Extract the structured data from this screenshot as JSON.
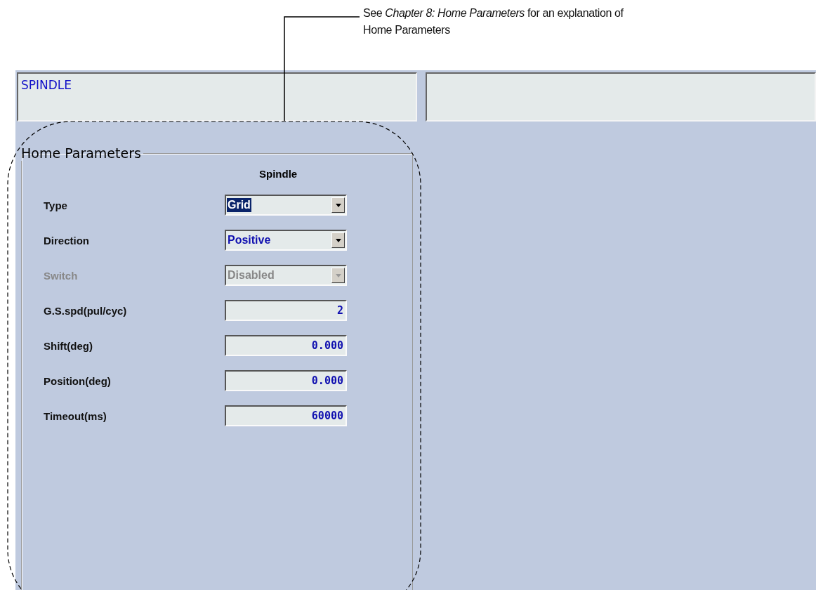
{
  "callout": {
    "text": "See *Chapter 8: Home Parameters* for an explanation of Home Parameters"
  },
  "header": {
    "title": "SPINDLE"
  },
  "group": {
    "title": "Home Parameters",
    "column": "Spindle",
    "rows": [
      {
        "kind": "dropdown",
        "label": "Type",
        "value": "Grid",
        "highlighted": true,
        "disabled": false
      },
      {
        "kind": "dropdown",
        "label": "Direction",
        "value": "Positive",
        "highlighted": false,
        "disabled": false
      },
      {
        "kind": "dropdown",
        "label": "Switch",
        "value": "Disabled",
        "highlighted": false,
        "disabled": true
      },
      {
        "kind": "number",
        "label": "G.S.spd(pul/cyc)",
        "value": "2",
        "highlighted": false,
        "disabled": false
      },
      {
        "kind": "number",
        "label": "Shift(deg)",
        "value": "0.000",
        "highlighted": false,
        "disabled": false
      },
      {
        "kind": "number",
        "label": "Position(deg)",
        "value": "0.000",
        "highlighted": false,
        "disabled": false
      },
      {
        "kind": "number",
        "label": "Timeout(ms)",
        "value": "60000",
        "highlighted": false,
        "disabled": false
      }
    ]
  }
}
